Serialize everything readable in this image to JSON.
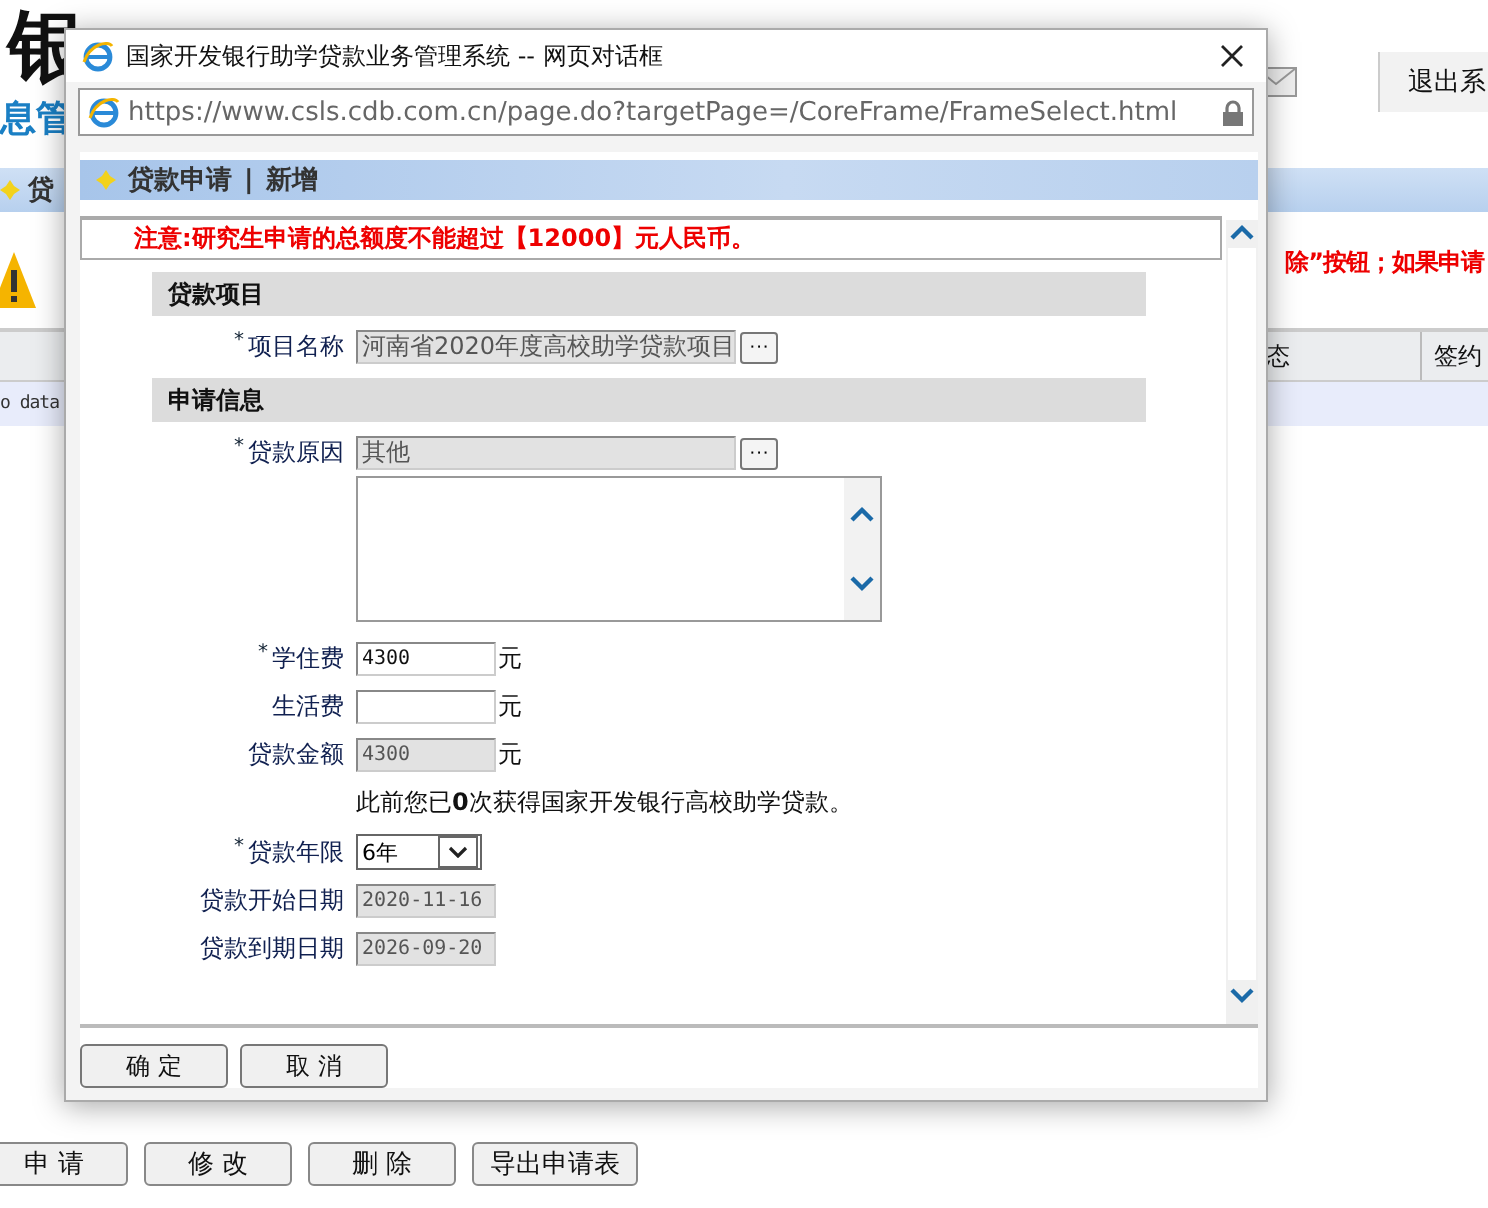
{
  "background": {
    "logo_text": "银",
    "logo_subtitle": "息管",
    "logout": "退出系",
    "section_title": "贷",
    "warning_text": "除”按钮；如果申请",
    "table": {
      "columns": [
        "态",
        "签约"
      ],
      "empty_text": "o data"
    },
    "buttons": [
      "申 请",
      "修 改",
      "删 除",
      "导出申请表"
    ]
  },
  "dialog": {
    "title": "国家开发银行助学贷款业务管理系统 -- 网页对话框",
    "url": "https://www.csls.cdb.com.cn/page.do?targetPage=/CoreFrame/FrameSelect.html",
    "header": {
      "items": [
        "贷款申请",
        "新增"
      ],
      "separator": "|"
    },
    "notice": "注意:研究生申请的总额度不能超过【12000】元人民币。",
    "sections": [
      {
        "title": "贷款项目",
        "rows": [
          {
            "kind": "lookup",
            "mark": "*",
            "label": "项目名称",
            "value": "河南省2020年度高校助学贷款项目",
            "button": "···"
          }
        ]
      },
      {
        "title": "申请信息",
        "rows": [
          {
            "kind": "lookup",
            "mark": "*",
            "label": "贷款原因",
            "value": "其他",
            "button": "···"
          },
          {
            "kind": "textarea"
          },
          {
            "kind": "money",
            "mark": "*",
            "label": "学住费",
            "value": "4300",
            "unit": "元",
            "readonly": false
          },
          {
            "kind": "money",
            "label": "生活费",
            "unit": "元",
            "readonly": false
          },
          {
            "kind": "money",
            "label": "贷款金额",
            "value": "4300",
            "unit": "元",
            "readonly": true
          },
          {
            "kind": "note",
            "text": "此前您已**0**次获得国家开发银行高校助学贷款。"
          },
          {
            "kind": "select",
            "mark": "*",
            "label": "贷款年限",
            "value": "6年"
          },
          {
            "kind": "date",
            "label": "贷款开始日期",
            "value": "2020-11-16"
          },
          {
            "kind": "date",
            "label": "贷款到期日期",
            "value": "2026-09-20"
          }
        ]
      }
    ],
    "buttons": [
      "确 定",
      "取 消"
    ]
  }
}
